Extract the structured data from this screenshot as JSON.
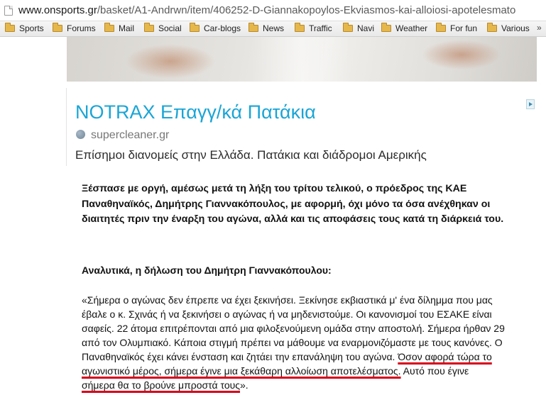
{
  "browser": {
    "url_host": "www.onsports.gr",
    "url_path": "/basket/A1-Andrwn/item/406252-D-Giannakopoylos-Ekviasmos-kai-alloiosi-apotelesmato",
    "bookmarks": [
      "Sports",
      "Forums",
      "Mail",
      "Social",
      "Car-blogs",
      "News",
      "Traffic",
      "Navi",
      "Weather",
      "For fun",
      "Various"
    ],
    "bookmarks_more": "»"
  },
  "ad": {
    "title": "NOTRAX Επαγγ/κά Πατάκια",
    "domain": "supercleaner.gr",
    "description": "Επίσημοι διανομείς στην Ελλάδα. Πατάκια και διάδρομοι Αμερικής",
    "title_color": "#1aa5d6"
  },
  "article": {
    "lead": "Ξέσπασε με οργή, αμέσως μετά τη λήξη του τρίτου τελικού, ο πρόεδρος της ΚΑΕ Παναθηναϊκός, Δημήτρης Γιαννακόπουλος, με αφορμή, όχι μόνο τα όσα ανέχθηκαν οι διαιτητές πριν την έναρξη του αγώνα, αλλά και τις αποφάσεις τους κατά τη διάρκειά του.",
    "subhead": "Αναλυτικά, η δήλωση του Δημήτρη Γιαννακόπουλου:",
    "quote_lines": [
      "«Σήμερα ο αγώνας δεν έπρεπε να έχει ξεκινήσει. Ξεκίνησε εκβιαστικά μ' ένα δίλημμα που μας",
      "έβαλε ο κ. Σχινάς ή να  ξεκινήσει ο αγώνας ή να μηδενιστούμε. Οι κανονισμοί του ΕΣΑΚΕ είναι",
      "σαφείς. 22 άτομα επιτρέπονται από μια φιλοξενούμενη ομάδα στην αποστολή. Σήμερα ήρθαν 29",
      "από τον Ολυμπιακό. Κάποια στιγμή πρέπει να μάθουμε να εναρμονιζόμαστε με τους κανόνες. Ο"
    ],
    "quote_line5_plain": "Παναθηναϊκός έχει κάνει ένσταση και ζητάει την επανάληψη του αγώνα. ",
    "quote_line5_underlined": "Όσον αφορά τώρα το",
    "quote_line6_underlined": "αγωνιστικό μέρος, σήμερα έγινε μια ξεκάθαρη αλλοίωση αποτελέσματος.",
    "quote_line6_plain": " Αυτό που έγινε",
    "quote_line7_underlined": "σήμερα θα το βρούνε μπροστά τους",
    "quote_line7_plain": "».",
    "underline_color": "#d8001a"
  }
}
